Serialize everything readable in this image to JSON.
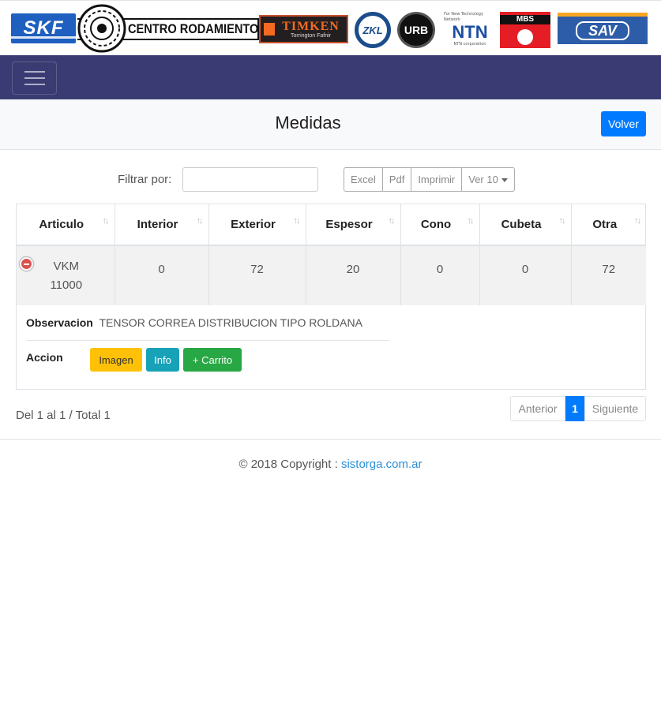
{
  "brands": {
    "skf": "SKF",
    "centro": "CENTRO RODAMIENTOS S.R.L.",
    "timken": "TIMKEN",
    "timken_sub": "Torrington   Fafnir",
    "zkl": "ZKL",
    "urb": "URB",
    "ntn_tag": "For New Technology Network",
    "ntn": "NTN",
    "ntn_sub": "NTN corporation",
    "mbs": "MBS",
    "sav": "SAV"
  },
  "page": {
    "title": "Medidas",
    "back_button": "Volver"
  },
  "filter": {
    "label": "Filtrar por:",
    "value": "",
    "placeholder": ""
  },
  "export_buttons": {
    "excel": "Excel",
    "pdf": "Pdf",
    "print": "Imprimir",
    "page_size": "Ver 10"
  },
  "table": {
    "columns": [
      "Articulo",
      "Interior",
      "Exterior",
      "Espesor",
      "Cono",
      "Cubeta",
      "Otra"
    ],
    "sort_glyph": "↑↓",
    "rows": [
      {
        "articulo": "VKM 11000",
        "interior": "0",
        "exterior": "72",
        "espesor": "20",
        "cono": "0",
        "cubeta": "0",
        "otra": "72"
      }
    ],
    "detail": {
      "obs_label": "Observacion",
      "obs_value": "TENSOR CORREA DISTRIBUCION TIPO ROLDANA",
      "accion_label": "Accion",
      "btn_imagen": "Imagen",
      "btn_info": "Info",
      "btn_carrito": "+ Carrito"
    }
  },
  "pagination": {
    "summary": "Del 1 al 1 / Total 1",
    "prev": "Anterior",
    "current": "1",
    "next": "Siguiente"
  },
  "footer": {
    "copyright": "© 2018 Copyright :",
    "link": "sistorga.com.ar"
  },
  "colors": {
    "navbar": "#3b3b73",
    "primary": "#007bff",
    "warning": "#ffc107",
    "info": "#17a2b8",
    "success": "#28a745",
    "danger": "#d9534f"
  }
}
